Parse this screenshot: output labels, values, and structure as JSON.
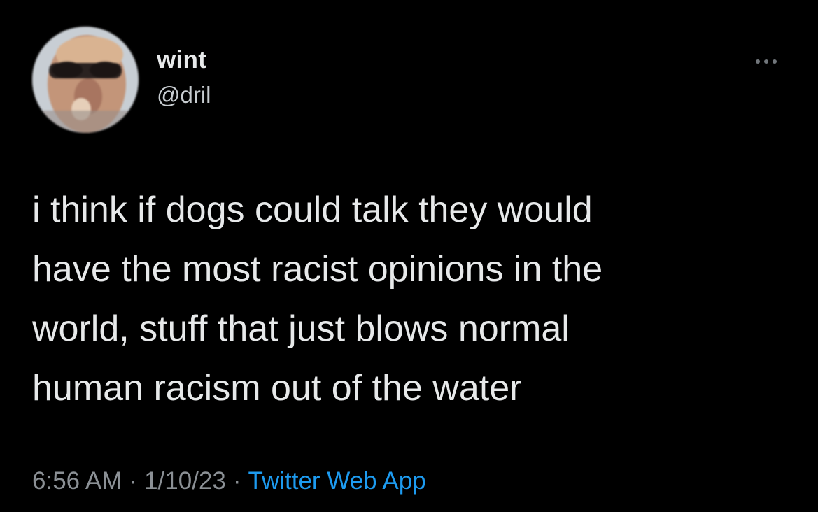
{
  "tweet": {
    "author": {
      "display_name": "wint",
      "handle": "@dril"
    },
    "text": "i think if dogs could talk they would\nhave the most racist opinions in the\nworld, stuff that just blows normal\nhuman racism out of the water",
    "time": "6:56 AM",
    "separator": "·",
    "date": "1/10/23",
    "source": "Twitter Web App",
    "more_icon": "more-horizontal-icon"
  },
  "colors": {
    "background": "#000000",
    "text_primary": "#e7e9ea",
    "text_secondary": "#8b9095",
    "link": "#1d9bf0"
  }
}
